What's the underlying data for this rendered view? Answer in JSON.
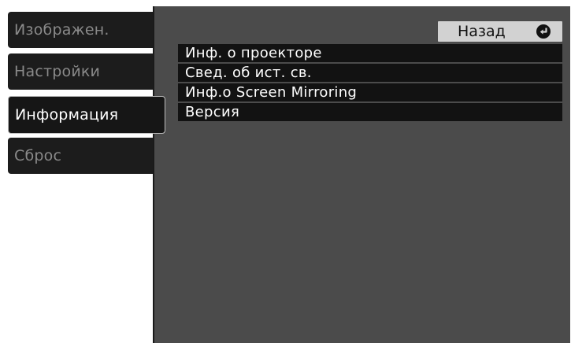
{
  "tabs": [
    {
      "label": "Изображен."
    },
    {
      "label": "Настройки"
    },
    {
      "label": "Информация"
    },
    {
      "label": "Сброс"
    }
  ],
  "active_tab_index": 2,
  "back_button": {
    "label": "Назад",
    "icon": "back-arrow-circle-icon"
  },
  "menu_items": [
    {
      "label": "Инф. о проекторе"
    },
    {
      "label": "Свед. об ист. св."
    },
    {
      "label": "Инф.о Screen Mirroring"
    },
    {
      "label": "Версия"
    }
  ],
  "colors": {
    "panel_bg": "#4b4b4b",
    "tab_bg": "#1c1c1c",
    "item_bg": "#121212",
    "back_button_bg": "#d2d2d2",
    "inactive_tab_text": "#8a8a8a",
    "active_text": "#ffffff"
  }
}
